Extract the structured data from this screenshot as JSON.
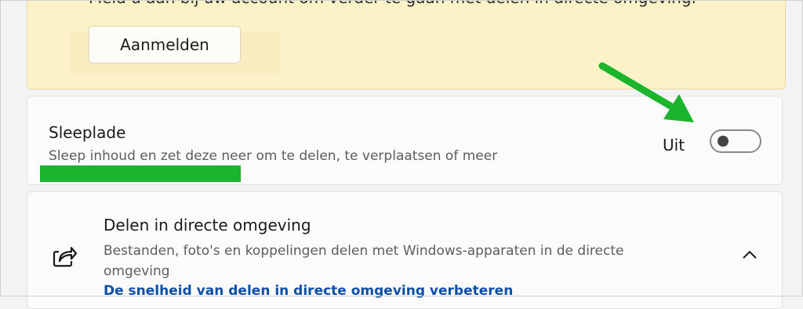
{
  "account_notice": {
    "text": "Meld u aan bij uw account om verder te gaan met delen in directe omgeving.",
    "signin_label": "Aanmelden"
  },
  "drag_tray": {
    "title": "Sleeplade",
    "description": "Sleep inhoud en zet deze neer om te delen, te verplaatsen of meer",
    "toggle_state": "Uit",
    "toggle_on": false
  },
  "nearby_sharing": {
    "title": "Delen in directe omgeving",
    "description": "Bestanden, foto's en koppelingen delen met Windows-apparaten in de directe omgeving",
    "link": "De snelheid van delen in directe omgeving verbeteren",
    "expanded": true
  },
  "colors": {
    "annotation_green": "#1ab52c",
    "notice_background": "#fcf2c8",
    "link": "#0b4fa8"
  },
  "icons": [
    "share-icon",
    "chevron-up-icon",
    "annotation-arrow"
  ]
}
